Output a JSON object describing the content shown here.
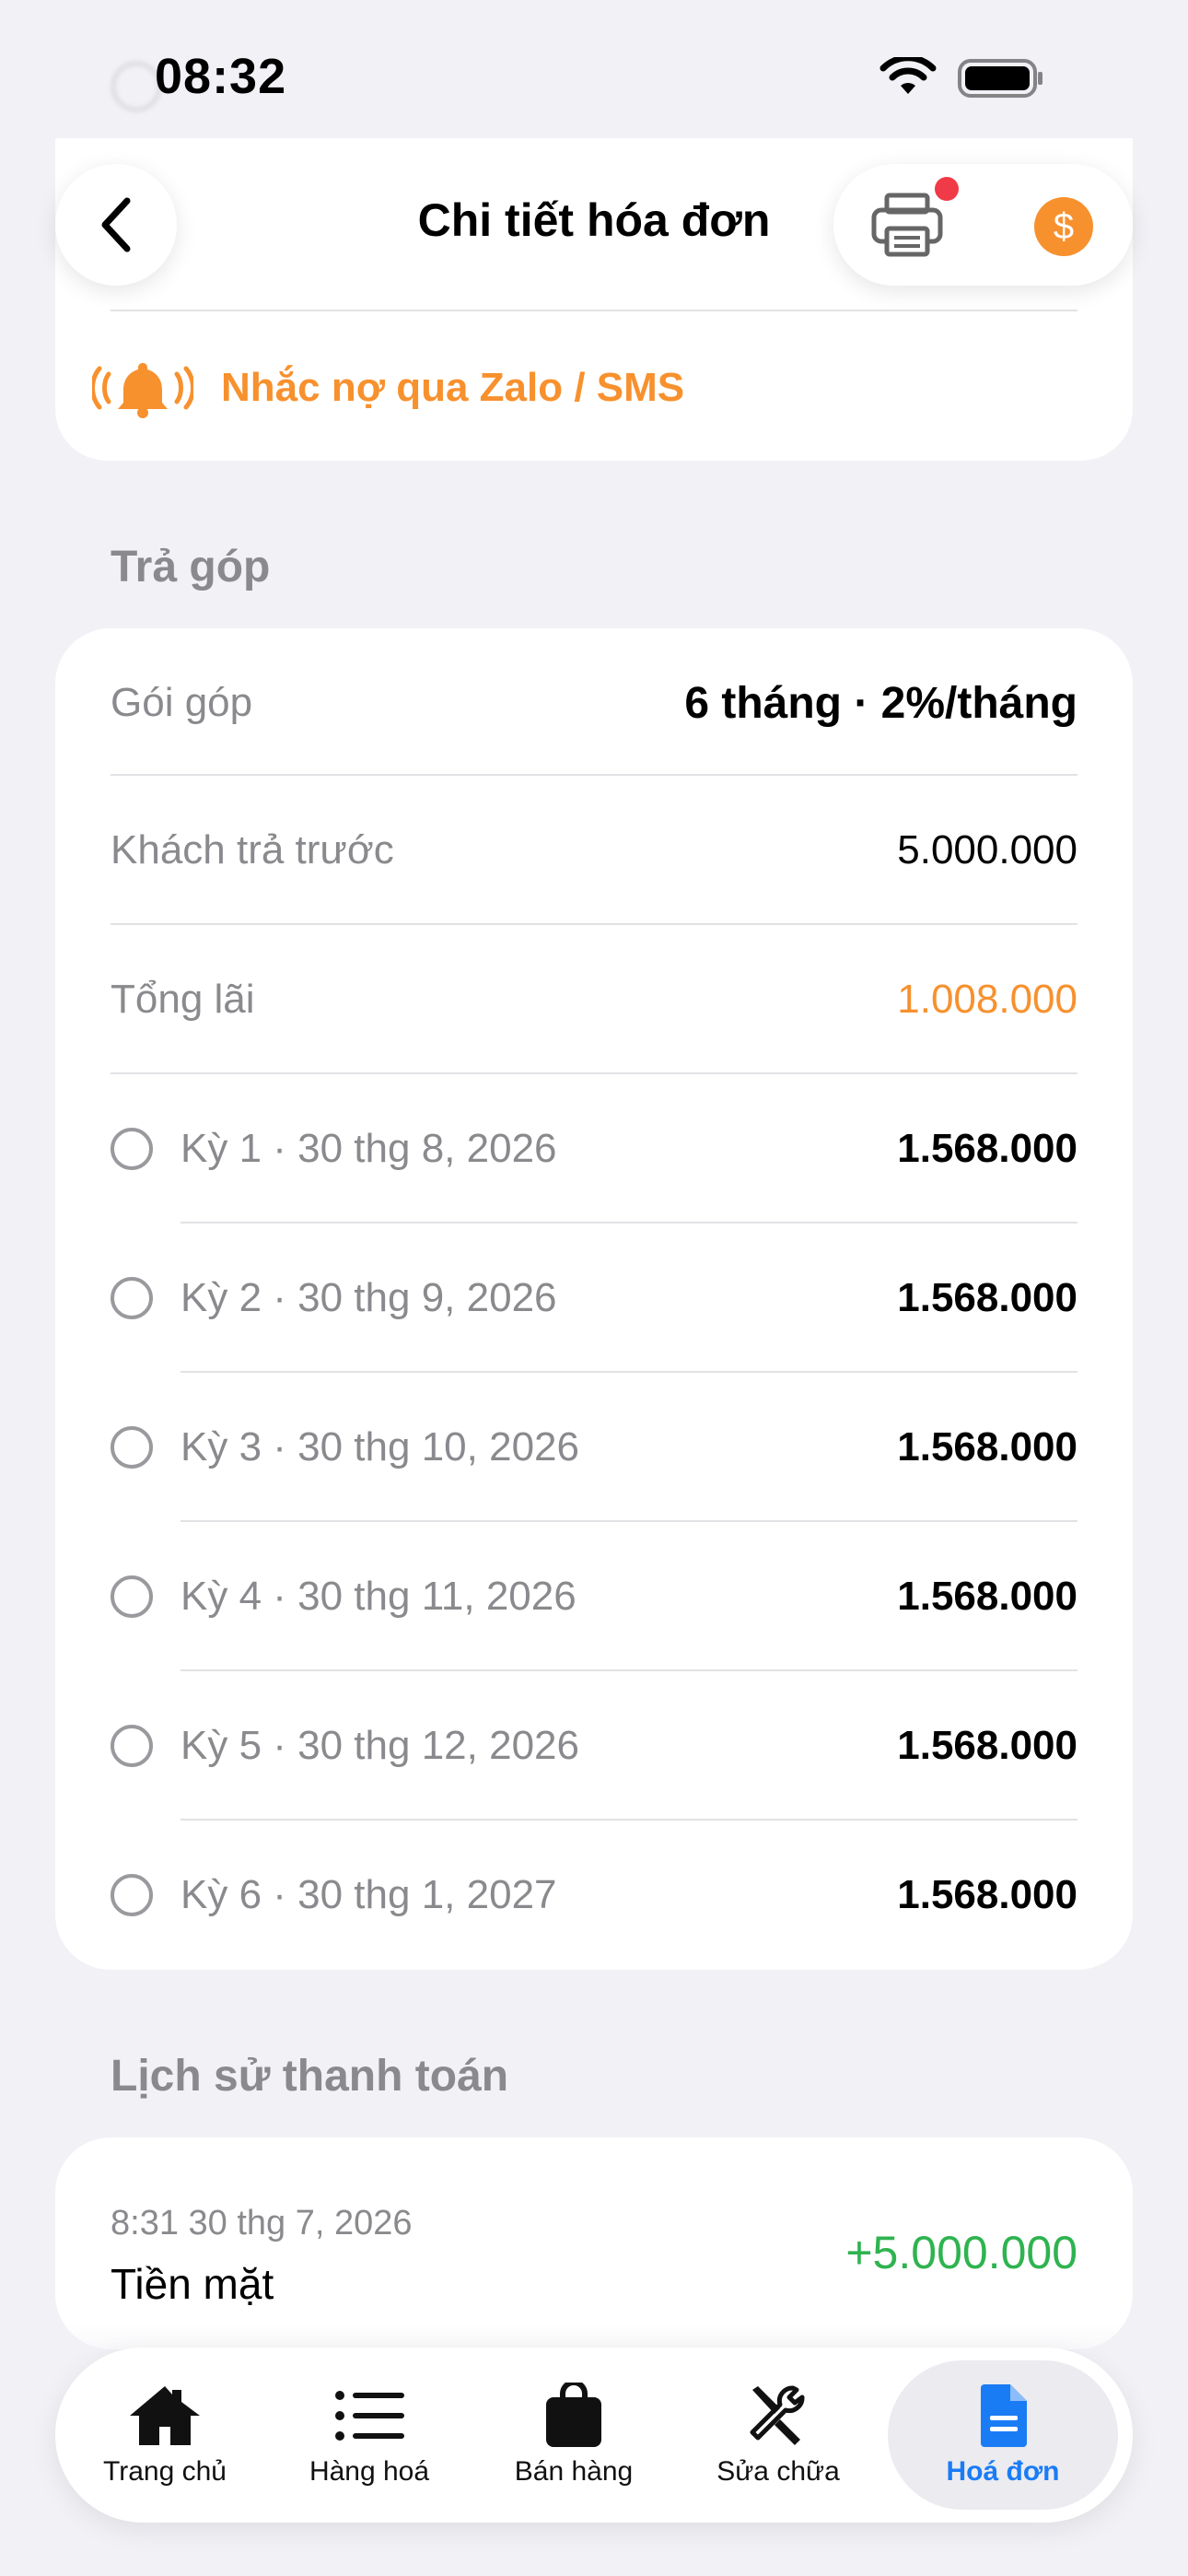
{
  "status_bar": {
    "time": "08:32"
  },
  "header": {
    "title": "Chi tiết hóa đơn",
    "coin_symbol": "$"
  },
  "top_card": {
    "reminder_label": "Nhắc nợ qua Zalo / SMS"
  },
  "installment": {
    "section_title": "Trả góp",
    "plan_label": "Gói góp",
    "plan_value": "6 tháng · 2%/tháng",
    "prepaid_label": "Khách trả trước",
    "prepaid_value": "5.000.000",
    "interest_label": "Tổng lãi",
    "interest_value": "1.008.000",
    "periods": [
      {
        "label": "Kỳ 1 · 30 thg 8, 2026",
        "amount": "1.568.000"
      },
      {
        "label": "Kỳ 2 · 30 thg 9, 2026",
        "amount": "1.568.000"
      },
      {
        "label": "Kỳ 3 · 30 thg 10, 2026",
        "amount": "1.568.000"
      },
      {
        "label": "Kỳ 4 · 30 thg 11, 2026",
        "amount": "1.568.000"
      },
      {
        "label": "Kỳ 5 · 30 thg 12, 2026",
        "amount": "1.568.000"
      },
      {
        "label": "Kỳ 6 · 30 thg 1, 2027",
        "amount": "1.568.000"
      }
    ]
  },
  "history": {
    "section_title": "Lịch sử thanh toán",
    "entries": [
      {
        "time": "8:31 30 thg 7, 2026",
        "method": "Tiền mặt",
        "amount": "+5.000.000"
      }
    ]
  },
  "tabbar": {
    "items": [
      {
        "label": "Trang chủ",
        "icon": "home-icon"
      },
      {
        "label": "Hàng hoá",
        "icon": "list-icon"
      },
      {
        "label": "Bán hàng",
        "icon": "bag-icon"
      },
      {
        "label": "Sửa chữa",
        "icon": "tools-icon"
      },
      {
        "label": "Hoá đơn",
        "icon": "invoice-icon",
        "active": true
      }
    ]
  },
  "colors": {
    "accent": "#1a7cf5",
    "orange": "#f7912e",
    "green": "#2fb350",
    "red": "#f03a47"
  }
}
